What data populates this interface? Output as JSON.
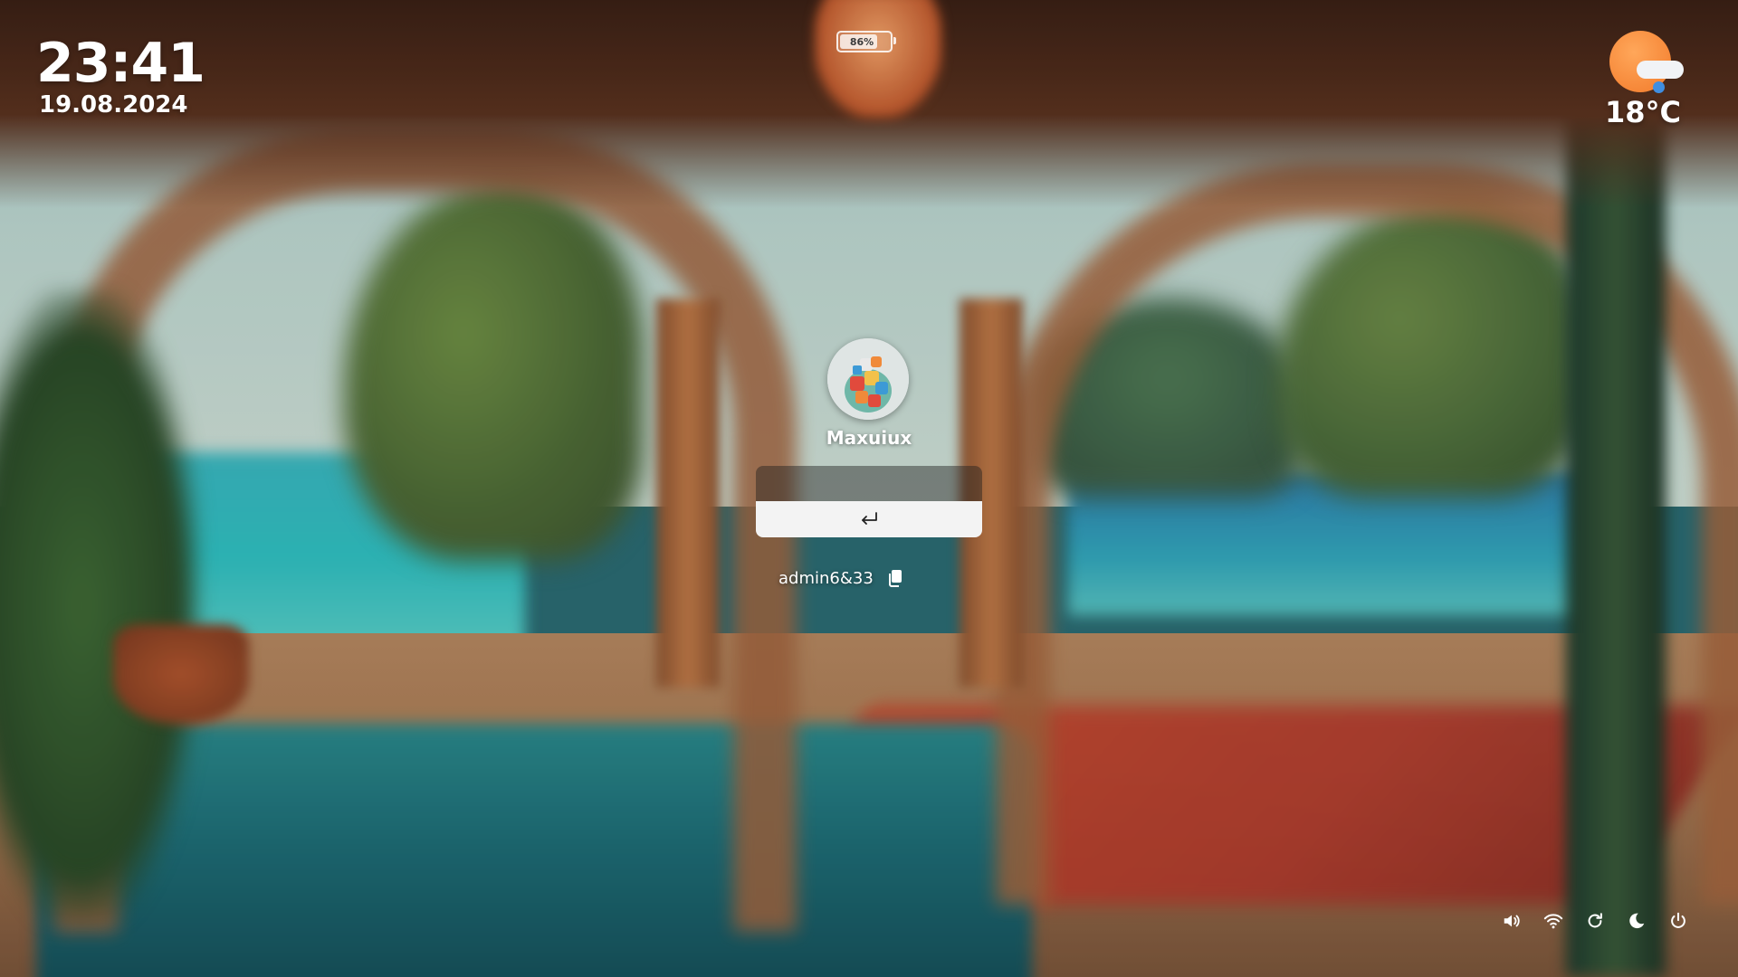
{
  "clock": {
    "time": "23:41",
    "date": "19.08.2024"
  },
  "battery": {
    "percent_label": "86%",
    "level": 0.86
  },
  "weather": {
    "temperature": "18°C",
    "icon": "partly-cloudy-rain-icon",
    "sun_color": "#f27a2a",
    "drop_color": "#3f8ee0"
  },
  "login": {
    "username": "Maxuiux",
    "password_value": "",
    "password_placeholder": "",
    "submit_icon": "enter-arrow-icon",
    "hint_text": "admin6&33",
    "copy_icon": "clipboard-icon"
  },
  "controls": [
    {
      "name": "volume",
      "icon": "speaker-icon"
    },
    {
      "name": "wifi",
      "icon": "wifi-icon"
    },
    {
      "name": "restart",
      "icon": "restart-icon"
    },
    {
      "name": "sleep",
      "icon": "moon-icon"
    },
    {
      "name": "shutdown",
      "icon": "power-icon"
    }
  ]
}
